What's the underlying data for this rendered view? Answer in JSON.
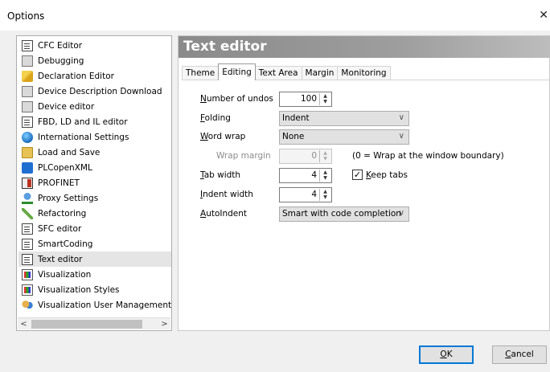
{
  "window": {
    "title": "Options",
    "close_glyph": "✕"
  },
  "sidebar": {
    "items": [
      {
        "label": "CFC Editor",
        "icon": "cfc-editor-icon"
      },
      {
        "label": "Debugging",
        "icon": "debugging-icon"
      },
      {
        "label": "Declaration Editor",
        "icon": "declaration-editor-icon"
      },
      {
        "label": "Device Description Download",
        "icon": "device-description-icon"
      },
      {
        "label": "Device editor",
        "icon": "device-editor-icon"
      },
      {
        "label": "FBD, LD and IL editor",
        "icon": "fbd-ld-il-icon"
      },
      {
        "label": "International Settings",
        "icon": "globe-icon"
      },
      {
        "label": "Load and Save",
        "icon": "folder-icon"
      },
      {
        "label": "PLCopenXML",
        "icon": "plcopenxml-icon"
      },
      {
        "label": "PROFINET",
        "icon": "profinet-icon"
      },
      {
        "label": "Proxy Settings",
        "icon": "proxy-icon"
      },
      {
        "label": "Refactoring",
        "icon": "refactoring-icon"
      },
      {
        "label": "SFC editor",
        "icon": "sfc-editor-icon"
      },
      {
        "label": "SmartCoding",
        "icon": "smartcoding-icon"
      },
      {
        "label": "Text editor",
        "icon": "text-editor-icon"
      },
      {
        "label": "Visualization",
        "icon": "visualization-icon"
      },
      {
        "label": "Visualization Styles",
        "icon": "visualization-styles-icon"
      },
      {
        "label": "Visualization User Management",
        "icon": "users-icon"
      }
    ],
    "selected": "Text editor",
    "scroll_left": "<",
    "scroll_right": ">"
  },
  "panel": {
    "title": "Text editor",
    "tabs": [
      "Theme",
      "Editing",
      "Text Area",
      "Margin",
      "Monitoring"
    ],
    "active_tab": "Editing",
    "fields": {
      "undos": {
        "label_key": "N",
        "label_rest": "umber of undos",
        "value": "100"
      },
      "folding": {
        "label_key": "F",
        "label_rest": "olding",
        "value": "Indent"
      },
      "wordwrap": {
        "label_key": "W",
        "label_rest": "ord wrap",
        "value": "None"
      },
      "wrapmargin": {
        "label": "Wrap margin",
        "value": "0",
        "hint": "(0 = Wrap at the window boundary)"
      },
      "tabwidth": {
        "label_key": "T",
        "label_rest": "ab width",
        "value": "4"
      },
      "keeptabs": {
        "label_key": "K",
        "label_rest": "eep tabs",
        "checked": true
      },
      "indentwidth": {
        "label_key": "I",
        "label_rest": "ndent width",
        "value": "4"
      },
      "autoindent": {
        "label_key": "A",
        "label_rest": "utoIndent",
        "value": "Smart with code completion"
      }
    }
  },
  "buttons": {
    "ok_key": "O",
    "ok_rest": "K",
    "cancel_key": "C",
    "cancel_rest": "ancel"
  }
}
